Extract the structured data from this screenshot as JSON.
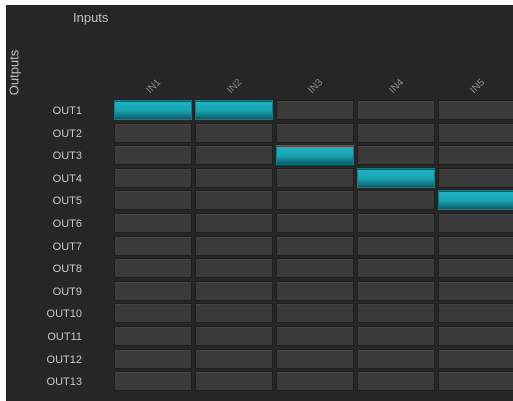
{
  "header": {
    "inputs_label": "Inputs",
    "outputs_label": "Outputs"
  },
  "inputs": [
    "IN1",
    "IN2",
    "IN3",
    "IN4",
    "IN5"
  ],
  "outputs": [
    "OUT1",
    "OUT2",
    "OUT3",
    "OUT4",
    "OUT5",
    "OUT6",
    "OUT7",
    "OUT8",
    "OUT9",
    "OUT10",
    "OUT11",
    "OUT12",
    "OUT13"
  ],
  "routing": [
    [
      1,
      1,
      0,
      0,
      0
    ],
    [
      0,
      0,
      0,
      0,
      0
    ],
    [
      0,
      0,
      1,
      0,
      0
    ],
    [
      0,
      0,
      0,
      1,
      0
    ],
    [
      0,
      0,
      0,
      0,
      1
    ],
    [
      0,
      0,
      0,
      0,
      0
    ],
    [
      0,
      0,
      0,
      0,
      0
    ],
    [
      0,
      0,
      0,
      0,
      0
    ],
    [
      0,
      0,
      0,
      0,
      0
    ],
    [
      0,
      0,
      0,
      0,
      0
    ],
    [
      0,
      0,
      0,
      0,
      0
    ],
    [
      0,
      0,
      0,
      0,
      0
    ],
    [
      0,
      0,
      0,
      0,
      0
    ]
  ],
  "colors": {
    "active": "#1fb5c4",
    "cell": "#3a3a3a",
    "background": "#262626"
  }
}
